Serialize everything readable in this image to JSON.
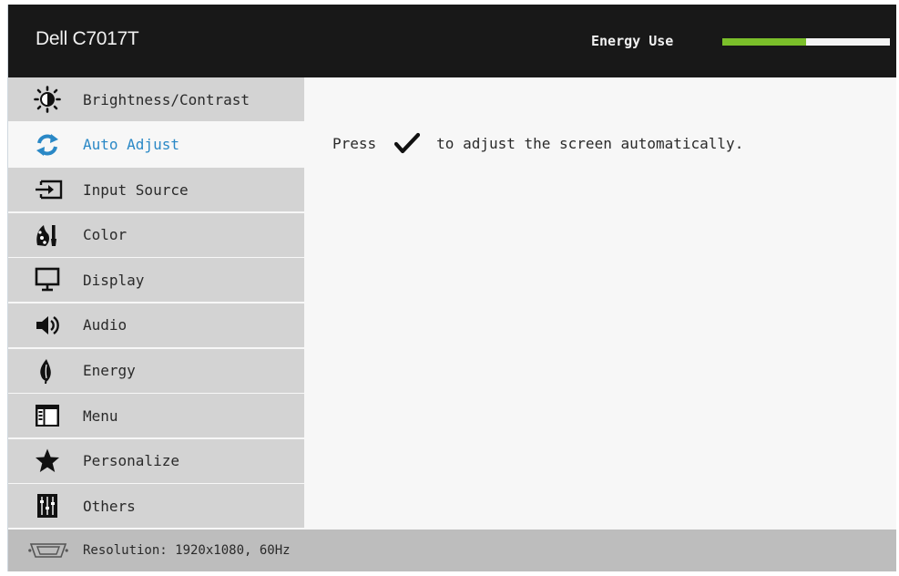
{
  "header": {
    "model": "Dell C7017T",
    "energy_label": "Energy Use",
    "energy_level": 0.5,
    "energy_color": "#7bbf2a"
  },
  "menu": {
    "items": [
      {
        "label": "Brightness/Contrast",
        "icon": "brightness-icon"
      },
      {
        "label": "Auto Adjust",
        "icon": "auto-adjust-icon",
        "active": true
      },
      {
        "label": "Input Source",
        "icon": "input-source-icon"
      },
      {
        "label": "Color",
        "icon": "color-palette-icon"
      },
      {
        "label": "Display",
        "icon": "display-monitor-icon"
      },
      {
        "label": "Audio",
        "icon": "speaker-icon"
      },
      {
        "label": "Energy",
        "icon": "leaf-icon"
      },
      {
        "label": "Menu",
        "icon": "menu-window-icon"
      },
      {
        "label": "Personalize",
        "icon": "star-icon"
      },
      {
        "label": "Others",
        "icon": "others-sliders-icon"
      }
    ],
    "accent_color": "#2a88c6"
  },
  "content": {
    "press": "Press",
    "check_icon": "checkmark-icon",
    "rest": "to adjust the screen automatically."
  },
  "footer": {
    "icon": "vga-connector-icon",
    "resolution": "Resolution: 1920x1080, 60Hz"
  }
}
